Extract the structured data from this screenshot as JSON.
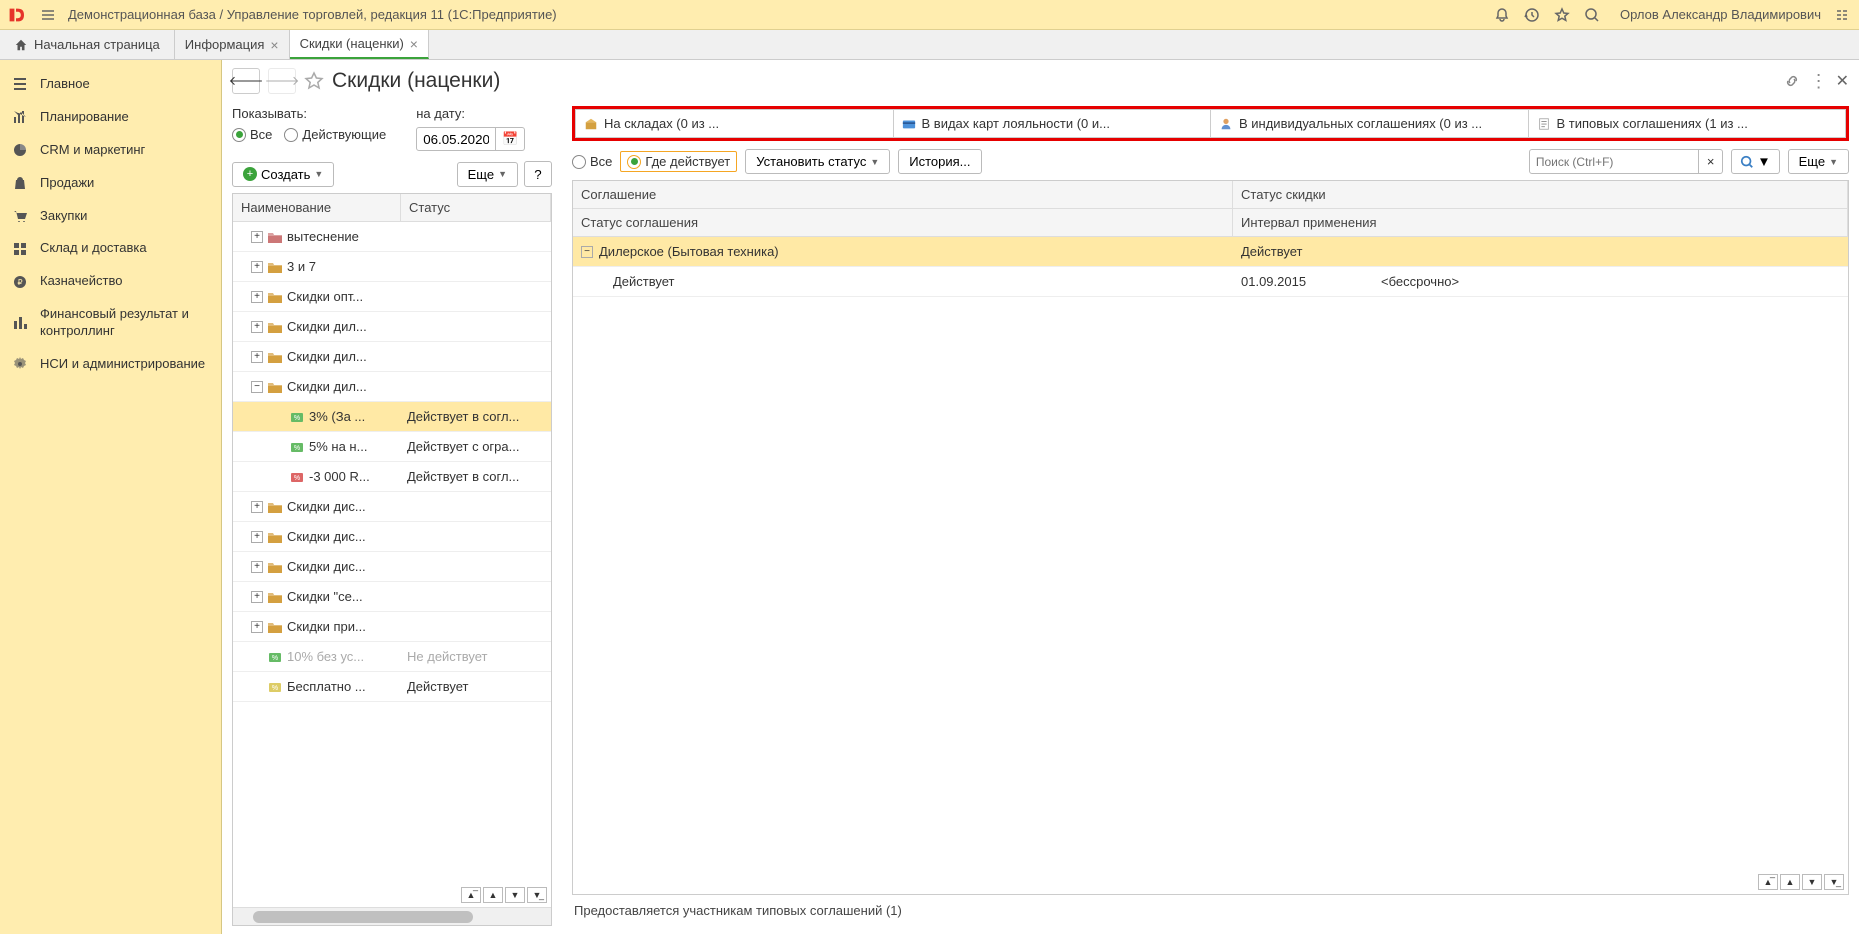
{
  "topbar": {
    "title": "Демонстрационная база / Управление торговлей, редакция 11  (1С:Предприятие)",
    "user": "Орлов Александр Владимирович"
  },
  "tabs": {
    "home": "Начальная страница",
    "items": [
      {
        "label": "Информация",
        "active": false
      },
      {
        "label": "Скидки (наценки)",
        "active": true
      }
    ]
  },
  "sidebar": {
    "items": [
      "Главное",
      "Планирование",
      "CRM и маркетинг",
      "Продажи",
      "Закупки",
      "Склад и доставка",
      "Казначейство",
      "Финансовый результат и контроллинг",
      "НСИ и администрирование"
    ]
  },
  "page": {
    "title": "Скидки (наценки)"
  },
  "filter": {
    "show_label": "Показывать:",
    "all": "Все",
    "active": "Действующие",
    "date_label": "на дату:",
    "date": "06.05.2020"
  },
  "left_toolbar": {
    "create": "Создать",
    "more": "Еще",
    "hint": "?"
  },
  "tree": {
    "col_name": "Наименование",
    "col_status": "Статус",
    "rows": [
      {
        "name": "вытеснение",
        "status": "",
        "level": 0,
        "type": "folder-red",
        "exp": "plus"
      },
      {
        "name": "3 и 7",
        "status": "",
        "level": 0,
        "type": "folder",
        "exp": "plus"
      },
      {
        "name": "Скидки опт...",
        "status": "",
        "level": 0,
        "type": "folder",
        "exp": "plus"
      },
      {
        "name": "Скидки дил...",
        "status": "",
        "level": 0,
        "type": "folder",
        "exp": "plus"
      },
      {
        "name": "Скидки дил...",
        "status": "",
        "level": 0,
        "type": "folder",
        "exp": "plus"
      },
      {
        "name": "Скидки дил...",
        "status": "",
        "level": 0,
        "type": "folder",
        "exp": "minus"
      },
      {
        "name": "3% (За ...",
        "status": "Действует в согл...",
        "level": 1,
        "type": "disc-green",
        "selected": true
      },
      {
        "name": "5% на н...",
        "status": "Действует с огра...",
        "level": 1,
        "type": "disc-green"
      },
      {
        "name": "-3 000 R...",
        "status": "Действует в согл...",
        "level": 1,
        "type": "disc-red"
      },
      {
        "name": "Скидки дис...",
        "status": "",
        "level": 0,
        "type": "folder",
        "exp": "plus"
      },
      {
        "name": "Скидки дис...",
        "status": "",
        "level": 0,
        "type": "folder",
        "exp": "plus"
      },
      {
        "name": "Скидки дис...",
        "status": "",
        "level": 0,
        "type": "folder",
        "exp": "plus"
      },
      {
        "name": "Скидки \"се...",
        "status": "",
        "level": 0,
        "type": "folder",
        "exp": "plus"
      },
      {
        "name": "Скидки при...",
        "status": "",
        "level": 0,
        "type": "folder",
        "exp": "plus"
      },
      {
        "name": "10% без ус...",
        "status": "Не действует",
        "level": 0,
        "type": "disc-green",
        "disabled": true
      },
      {
        "name": "Бесплатно ...",
        "status": "Действует",
        "level": 0,
        "type": "disc-yellow"
      }
    ]
  },
  "right_tabs": [
    {
      "label": "На складах (0 из ...",
      "icon": "warehouse"
    },
    {
      "label": "В видах карт лояльности (0 и...",
      "icon": "card"
    },
    {
      "label": "В индивидуальных соглашениях (0 из ...",
      "icon": "person"
    },
    {
      "label": "В типовых соглашениях (1 из ...",
      "icon": "doc"
    }
  ],
  "right_filter": {
    "all": "Все",
    "where": "Где действует",
    "set_status": "Установить статус",
    "history": "История...",
    "search_placeholder": "Поиск (Ctrl+F)",
    "more": "Еще"
  },
  "right_grid": {
    "h1a": "Соглашение",
    "h1b": "Статус скидки",
    "h2a": "Статус соглашения",
    "h2b": "Интервал применения",
    "rows": [
      {
        "c1": "Дилерское (Бытовая техника)",
        "c2": "Действует",
        "c3": "",
        "sel": true,
        "exp": "minus"
      },
      {
        "c1": "Действует",
        "c2": "01.09.2015",
        "c3": "<бессрочно>",
        "indent": true
      }
    ]
  },
  "footer": "Предоставляется участникам типовых соглашений (1)"
}
